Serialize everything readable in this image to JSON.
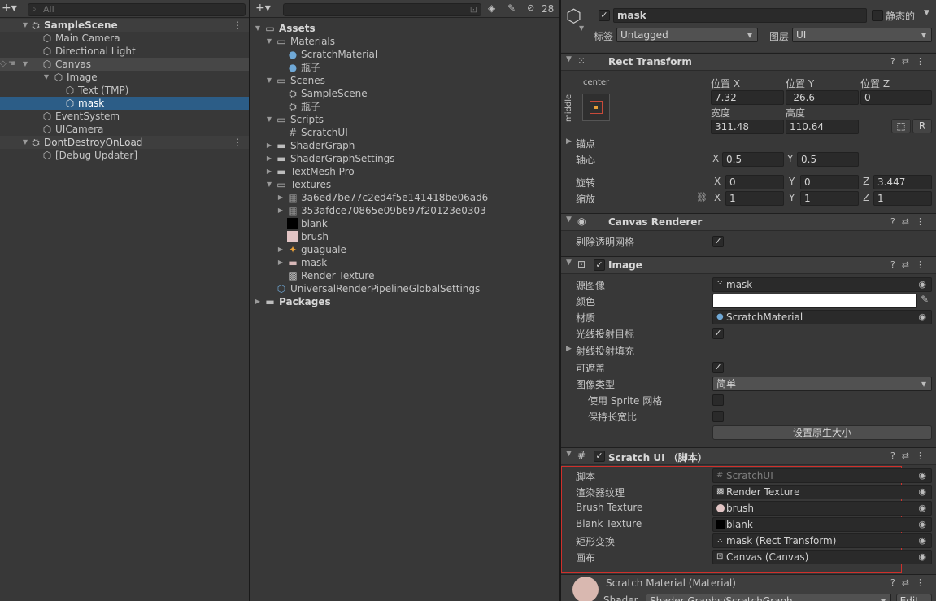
{
  "hierarchy": {
    "search_placeholder": "All",
    "items": [
      {
        "label": "SampleScene",
        "kind": "scene"
      },
      {
        "label": "Main Camera"
      },
      {
        "label": "Directional Light"
      },
      {
        "label": "Canvas"
      },
      {
        "label": "Image"
      },
      {
        "label": "Text (TMP)"
      },
      {
        "label": "mask"
      },
      {
        "label": "EventSystem"
      },
      {
        "label": "UICamera"
      },
      {
        "label": "DontDestroyOnLoad",
        "kind": "scene"
      },
      {
        "label": "[Debug Updater]"
      }
    ]
  },
  "project": {
    "hidden_count": "28",
    "items": [
      {
        "label": "Assets"
      },
      {
        "label": "Materials"
      },
      {
        "label": "ScratchMaterial"
      },
      {
        "label": "瓶子"
      },
      {
        "label": "Scenes"
      },
      {
        "label": "SampleScene"
      },
      {
        "label": "瓶子"
      },
      {
        "label": "Scripts"
      },
      {
        "label": "ScratchUI"
      },
      {
        "label": "ShaderGraph"
      },
      {
        "label": "ShaderGraphSettings"
      },
      {
        "label": "TextMesh Pro"
      },
      {
        "label": "Textures"
      },
      {
        "label": "3a6ed7be77c2ed4f5e141418be06ad6"
      },
      {
        "label": "353afdce70865e09b697f20123e0303"
      },
      {
        "label": "blank"
      },
      {
        "label": "brush"
      },
      {
        "label": "guaguale"
      },
      {
        "label": "mask"
      },
      {
        "label": "Render Texture"
      },
      {
        "label": "UniversalRenderPipelineGlobalSettings"
      },
      {
        "label": "Packages"
      }
    ]
  },
  "inspector": {
    "object_name": "mask",
    "static_label": "静态的",
    "tag_label": "标签",
    "tag_value": "Untagged",
    "layer_label": "图层",
    "layer_value": "UI",
    "rect_transform": {
      "title": "Rect Transform",
      "anchor_h": "center",
      "anchor_v": "middle",
      "pos_x_label": "位置 X",
      "pos_y_label": "位置 Y",
      "pos_z_label": "位置 Z",
      "pos_x": "7.32",
      "pos_y": "-26.6",
      "pos_z": "0",
      "width_label": "宽度",
      "height_label": "高度",
      "width": "311.48",
      "height": "110.64",
      "r_btn": "R",
      "anchors_label": "锚点",
      "pivot_label": "轴心",
      "pivot_x": "0.5",
      "pivot_y": "0.5",
      "rotation_label": "旋转",
      "rot_x": "0",
      "rot_y": "0",
      "rot_z": "3.447",
      "scale_label": "缩放",
      "scale_x": "1",
      "scale_y": "1",
      "scale_z": "1",
      "x": "X",
      "y": "Y",
      "z": "Z"
    },
    "canvas_renderer": {
      "title": "Canvas Renderer",
      "cull_label": "剔除透明网格"
    },
    "image": {
      "title": "Image",
      "source_label": "源图像",
      "source_value": "mask",
      "color_label": "颜色",
      "material_label": "材质",
      "material_value": "ScratchMaterial",
      "raycast_target_label": "光线投射目标",
      "raycast_padding_label": "射线投射填充",
      "maskable_label": "可遮盖",
      "image_type_label": "图像类型",
      "image_type_value": "简单",
      "use_sprite_mesh_label": "使用 Sprite 网格",
      "preserve_aspect_label": "保持长宽比",
      "native_size_button": "设置原生大小"
    },
    "scratch_ui": {
      "title": "Scratch UI （脚本）",
      "script_label": "脚本",
      "script_value": "ScratchUI",
      "render_tex_label": "渲染器纹理",
      "render_tex_value": "Render Texture",
      "brush_label": "Brush Texture",
      "brush_value": "brush",
      "blank_label": "Blank Texture",
      "blank_value": "blank",
      "rect_label": "矩形变换",
      "rect_value": "mask (Rect Transform)",
      "canvas_label": "画布",
      "canvas_value": "Canvas (Canvas)"
    },
    "material": {
      "title": "Scratch Material (Material)",
      "shader_label": "Shader",
      "shader_value": "Shader Graphs/ScratchGraph",
      "edit_button": "Edit..."
    }
  },
  "colors": {
    "selection": "#2c5d87",
    "highlight_box": "#d0302b",
    "panel": "#383838"
  }
}
